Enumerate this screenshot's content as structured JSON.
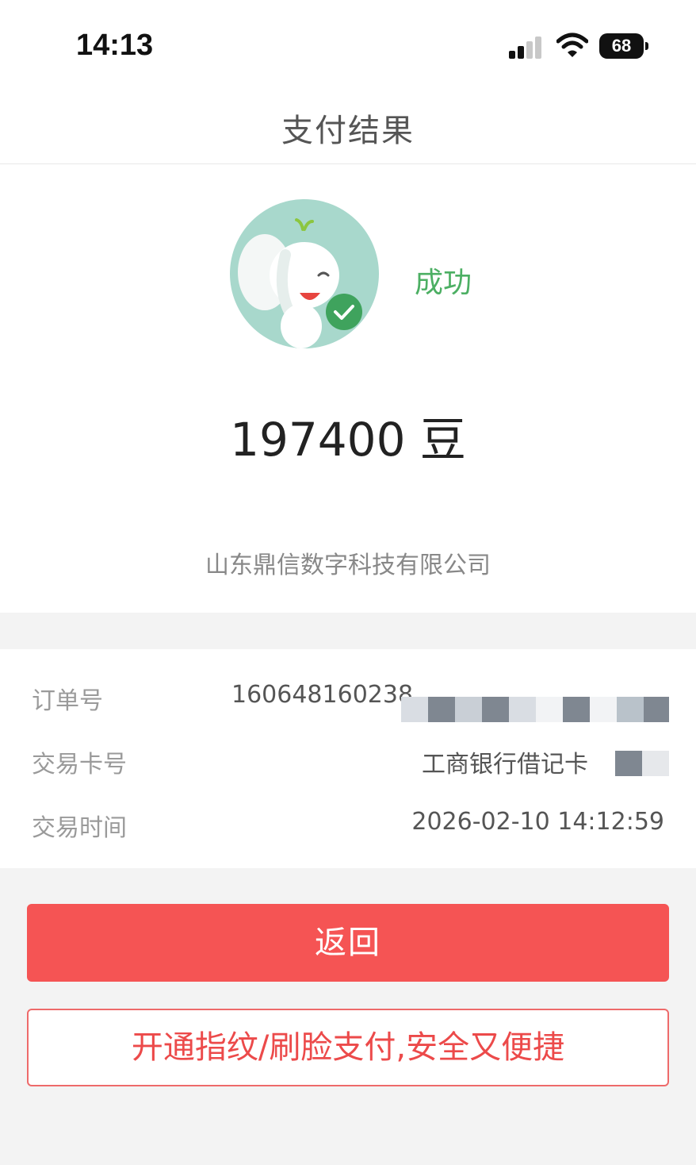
{
  "status_bar": {
    "time": "14:13",
    "battery": "68"
  },
  "header": {
    "title": "支付结果"
  },
  "result": {
    "status": "成功",
    "amount": "197400",
    "unit": "豆",
    "merchant": "山东鼎信数字科技有限公司"
  },
  "details": {
    "order": {
      "label": "订单号",
      "value": "160648160238"
    },
    "card": {
      "label": "交易卡号",
      "value": "工商银行借记卡"
    },
    "time": {
      "label": "交易时间",
      "value": "2026-02-10 14:12:59"
    }
  },
  "actions": {
    "back": "返回",
    "biometric": "开通指纹/刷脸支付,安全又便捷"
  },
  "colors": {
    "primary_red": "#f55454",
    "success_green": "#4caf63",
    "mascot_bg": "#a8d8cc"
  }
}
